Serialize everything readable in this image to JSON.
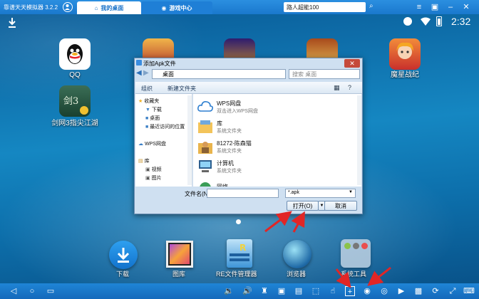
{
  "titlebar": {
    "app_title": "靠谱天天模拟器 3.2.2",
    "tabs": [
      {
        "label": "我的桌面"
      },
      {
        "label": "游戏中心"
      }
    ],
    "search_value": "路人超能100"
  },
  "status": {
    "time": "2:32"
  },
  "desktop_icons": [
    {
      "label": "QQ"
    },
    {
      "label": "剑网3指尖江湖"
    },
    {
      "label": "魔星战纪"
    }
  ],
  "dialog": {
    "title": "添加Apk文件",
    "address": "桌面",
    "search_placeholder": "搜索 桌面",
    "toolbar": {
      "organize": "组织",
      "new_folder": "新建文件夹"
    },
    "nav": [
      "收藏夹",
      "下载",
      "桌面",
      "最近访问的位置",
      "WPS网盘",
      "库",
      "视频",
      "图片"
    ],
    "files": [
      {
        "name": "WPS网盘",
        "type": "双击进入WPS网盘"
      },
      {
        "name": "库",
        "type": "系统文件夹"
      },
      {
        "name": "81272-陈森猫",
        "type": "系统文件夹"
      },
      {
        "name": "计算机",
        "type": "系统文件夹"
      },
      {
        "name": "网络",
        "type": ""
      }
    ],
    "filename_label": "文件名(N):",
    "filename_value": "",
    "filetype_value": "*.apk",
    "open_label": "打开(O)",
    "cancel_label": "取消"
  },
  "dock": [
    {
      "label": "下载"
    },
    {
      "label": "图库"
    },
    {
      "label": "RE文件管理器"
    },
    {
      "label": "浏览器"
    },
    {
      "label": "系统工具"
    }
  ],
  "colors": {
    "accent": "#1a78cd",
    "arrow": "#e12626"
  }
}
